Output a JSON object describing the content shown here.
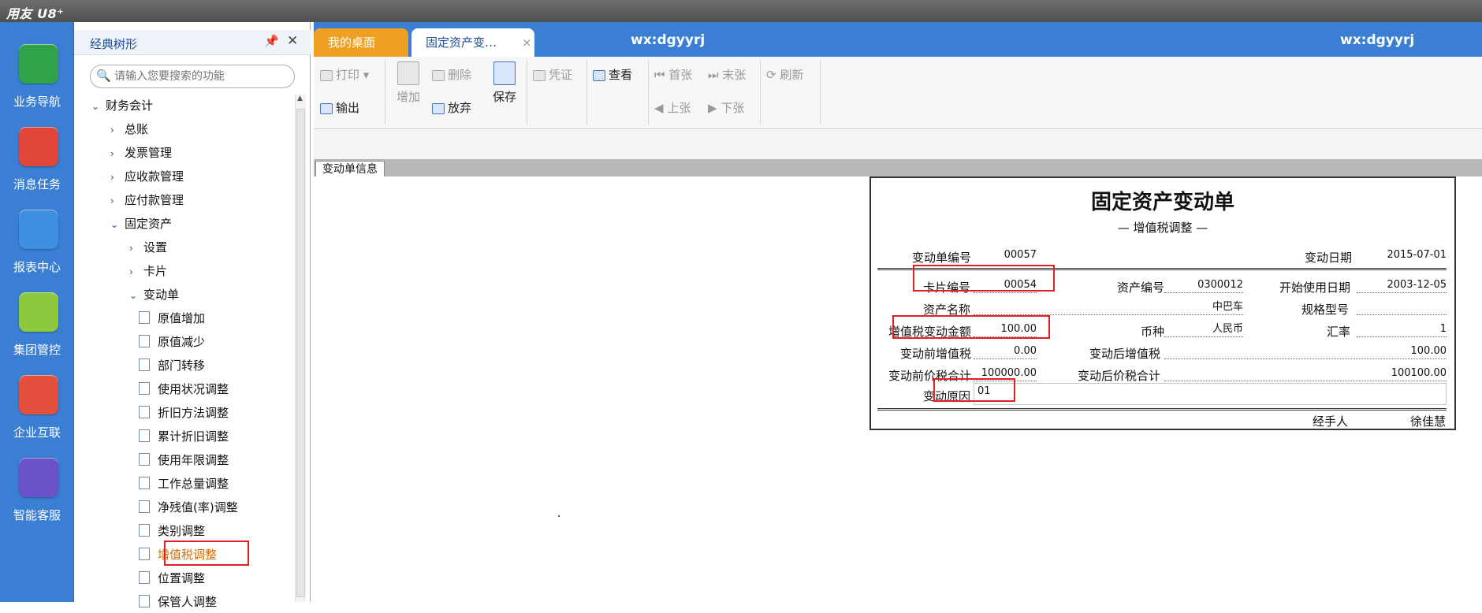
{
  "app": {
    "logo": "用友 U8⁺"
  },
  "nav": [
    {
      "label": "业务导航",
      "color": "#2fa24a"
    },
    {
      "label": "消息任务",
      "color": "#e2463a"
    },
    {
      "label": "报表中心",
      "color": "#3f8fe0"
    },
    {
      "label": "集团管控",
      "color": "#8cc93d"
    },
    {
      "label": "企业互联",
      "color": "#e4503e"
    },
    {
      "label": "智能客服",
      "color": "#6b52c9"
    }
  ],
  "tree": {
    "title": "经典树形",
    "search_placeholder": "请输入您要搜索的功能",
    "items": [
      {
        "label": "财务会计",
        "level": 0,
        "arrow": "⌄"
      },
      {
        "label": "总账",
        "level": 1,
        "arrow": "›"
      },
      {
        "label": "发票管理",
        "level": 1,
        "arrow": "›"
      },
      {
        "label": "应收款管理",
        "level": 1,
        "arrow": "›"
      },
      {
        "label": "应付款管理",
        "level": 1,
        "arrow": "›"
      },
      {
        "label": "固定资产",
        "level": 1,
        "arrow": "⌄"
      },
      {
        "label": "设置",
        "level": 2,
        "arrow": "›"
      },
      {
        "label": "卡片",
        "level": 2,
        "arrow": "›"
      },
      {
        "label": "变动单",
        "level": 2,
        "arrow": "⌄"
      },
      {
        "label": "原值增加",
        "level": 3
      },
      {
        "label": "原值减少",
        "level": 3
      },
      {
        "label": "部门转移",
        "level": 3
      },
      {
        "label": "使用状况调整",
        "level": 3
      },
      {
        "label": "折旧方法调整",
        "level": 3
      },
      {
        "label": "累计折旧调整",
        "level": 3
      },
      {
        "label": "使用年限调整",
        "level": 3
      },
      {
        "label": "工作总量调整",
        "level": 3
      },
      {
        "label": "净残值(率)调整",
        "level": 3
      },
      {
        "label": "类别调整",
        "level": 3
      },
      {
        "label": "增值税调整",
        "level": 3
      },
      {
        "label": "位置调整",
        "level": 3
      },
      {
        "label": "保管人调整",
        "level": 3
      }
    ]
  },
  "tabs": {
    "home": "我的桌面",
    "active": "固定资产变…",
    "close": "×"
  },
  "user": "wx:dgyyrj",
  "toolbar": {
    "print": "打印",
    "add": "增加",
    "delete": "删除",
    "save": "保存",
    "voucher": "凭证",
    "view": "查看",
    "first": "首张",
    "last": "末张",
    "refresh": "刷新",
    "export": "输出",
    "discard": "放弃",
    "prev": "上张",
    "next": "下张"
  },
  "subtab": "变动单信息",
  "form": {
    "title": "固定资产变动单",
    "subtitle": "— 增值税调整 —",
    "fields": {
      "doc_no_label": "变动单编号",
      "doc_no": "00057",
      "date_label": "变动日期",
      "date": "2015-07-01",
      "card_no_label": "卡片编号",
      "card_no": "00054",
      "asset_no_label": "资产编号",
      "asset_no": "0300012",
      "start_date_label": "开始使用日期",
      "start_date": "2003-12-05",
      "asset_name_label": "资产名称",
      "asset_name": "中巴车",
      "spec_label": "规格型号",
      "spec": "",
      "vat_change_label": "增值税变动金额",
      "vat_change": "100.00",
      "currency_label": "币种",
      "currency": "人民币",
      "rate_label": "汇率",
      "rate": "1",
      "vat_before_label": "变动前增值税",
      "vat_before": "0.00",
      "vat_after_label": "变动后增值税",
      "vat_after": "100.00",
      "total_before_label": "变动前价税合计",
      "total_before": "100000.00",
      "total_after_label": "变动后价税合计",
      "total_after": "100100.00",
      "reason_label": "变动原因",
      "reason": "01",
      "handler_label": "经手人",
      "handler": "徐佳慧"
    }
  }
}
